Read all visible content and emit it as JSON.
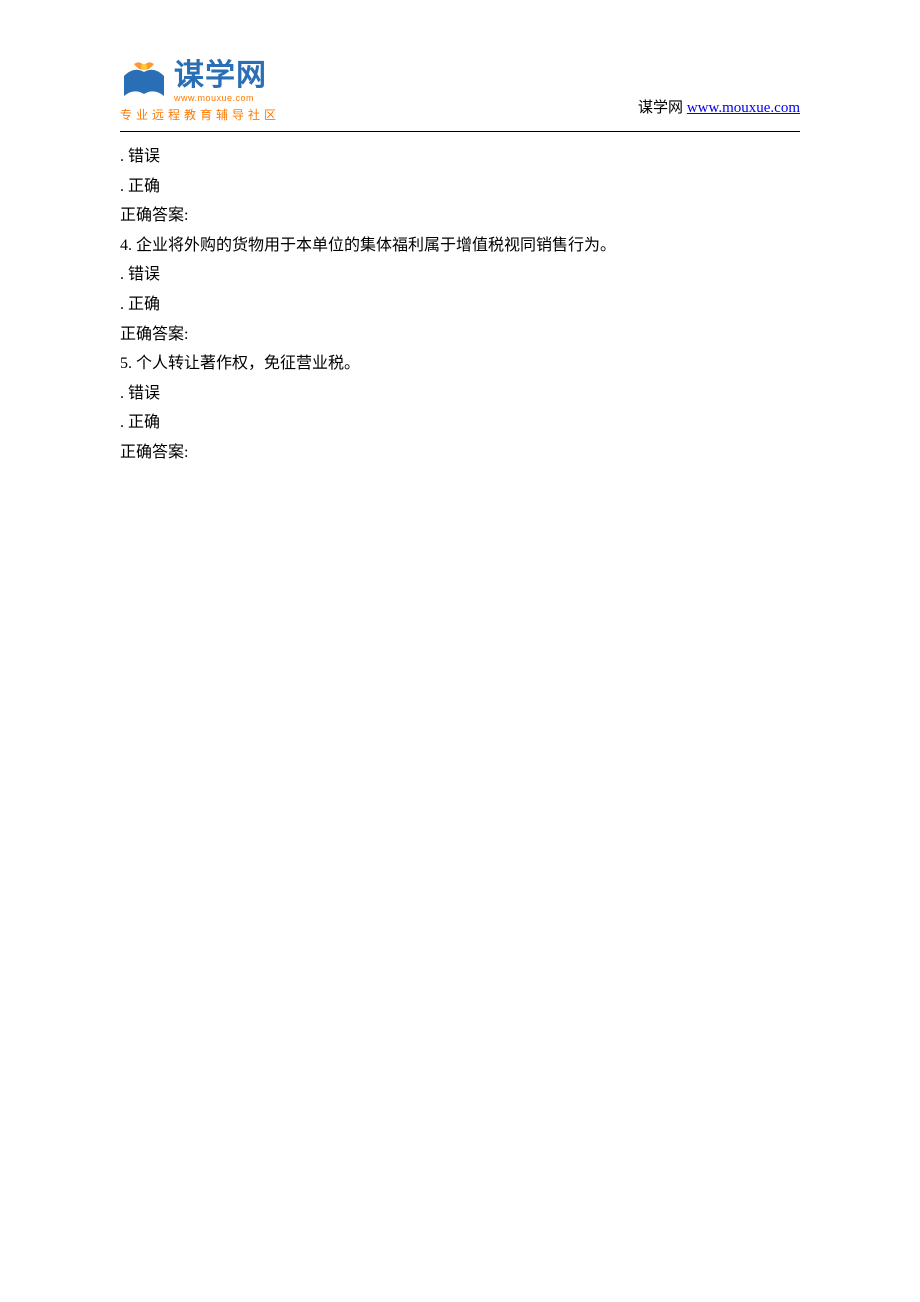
{
  "header": {
    "logo": {
      "title": "谋学网",
      "url_small": "www.mouxue.com",
      "tagline": "专业远程教育辅导社区"
    },
    "right_label": "谋学网 ",
    "right_link_text": "www.mouxue.com"
  },
  "content": {
    "lines": [
      {
        "type": "option",
        "text": ". 错误"
      },
      {
        "type": "option",
        "text": ". 正确"
      },
      {
        "type": "answer",
        "text": "正确答案:"
      },
      {
        "type": "question",
        "text": "4.  企业将外购的货物用于本单位的集体福利属于增值税视同销售行为。"
      },
      {
        "type": "option",
        "text": ". 错误"
      },
      {
        "type": "option",
        "text": ". 正确"
      },
      {
        "type": "answer",
        "text": "正确答案:"
      },
      {
        "type": "question",
        "text": "5.  个人转让著作权，免征营业税。"
      },
      {
        "type": "option",
        "text": ". 错误"
      },
      {
        "type": "option",
        "text": ". 正确"
      },
      {
        "type": "answer",
        "text": "正确答案:"
      }
    ]
  }
}
